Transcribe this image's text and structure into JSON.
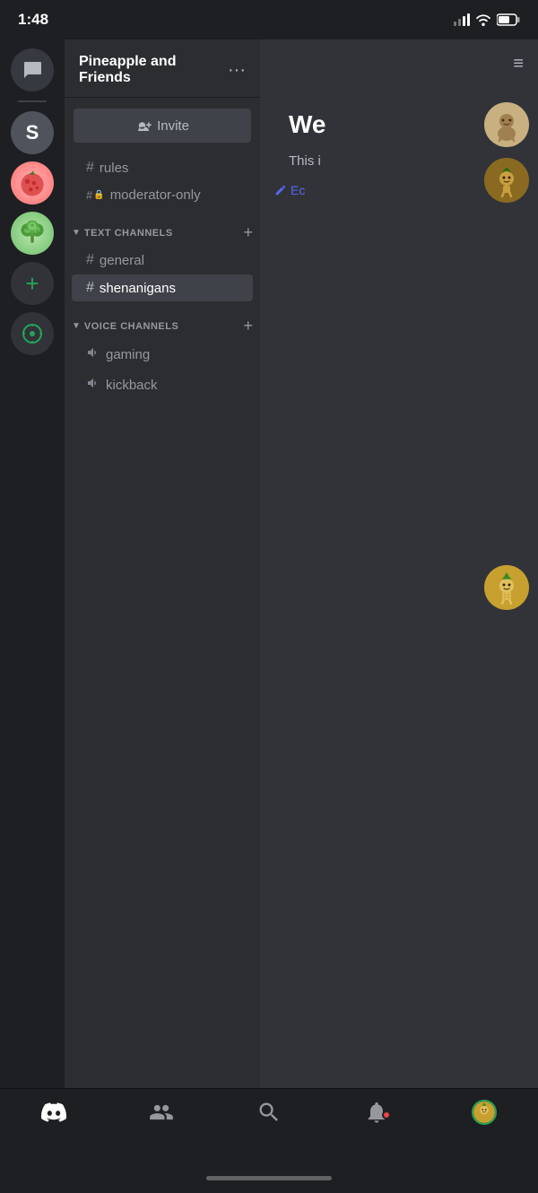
{
  "statusBar": {
    "time": "1:48",
    "signalBars": "▂▄",
    "wifi": "wifi",
    "battery": "battery"
  },
  "serverSidebar": {
    "items": [
      {
        "id": "chat",
        "type": "chat",
        "label": "Chat"
      },
      {
        "id": "s-server",
        "type": "letter",
        "letter": "S",
        "label": "S Server"
      },
      {
        "id": "strawberry",
        "type": "image",
        "label": "Strawberry Server"
      },
      {
        "id": "broccoli",
        "type": "image",
        "label": "Broccoli Server"
      },
      {
        "id": "add-server",
        "type": "add",
        "label": "Add Server"
      },
      {
        "id": "explore",
        "type": "explore",
        "label": "Explore Servers"
      }
    ]
  },
  "channelPanel": {
    "serverName": "Pineapple and Friends",
    "moreLabel": "···",
    "inviteButton": "Invite",
    "standaloneChannels": [
      {
        "id": "rules",
        "name": "rules",
        "icon": "#"
      },
      {
        "id": "moderator-only",
        "name": "moderator-only",
        "icon": "#🔒"
      }
    ],
    "categories": [
      {
        "id": "text-channels",
        "name": "TEXT CHANNELS",
        "channels": [
          {
            "id": "general",
            "name": "general",
            "icon": "#",
            "active": false
          },
          {
            "id": "shenanigans",
            "name": "shenanigans",
            "icon": "#",
            "active": true
          }
        ]
      },
      {
        "id": "voice-channels",
        "name": "VOICE CHANNELS",
        "channels": [
          {
            "id": "gaming",
            "name": "gaming",
            "icon": "🔊",
            "active": false
          },
          {
            "id": "kickback",
            "name": "kickback",
            "icon": "🔊",
            "active": false
          }
        ]
      }
    ]
  },
  "rightPanel": {
    "welcomeText": "We",
    "welcomeSub": "This i",
    "editLabel": "Ec"
  },
  "tabBar": {
    "tabs": [
      {
        "id": "home",
        "icon": "discord",
        "label": "Home"
      },
      {
        "id": "friends",
        "icon": "friends",
        "label": "Friends"
      },
      {
        "id": "search",
        "icon": "search",
        "label": "Search"
      },
      {
        "id": "notifications",
        "icon": "bell",
        "label": "Notifications",
        "badge": true
      },
      {
        "id": "profile",
        "icon": "profile",
        "label": "Profile"
      }
    ]
  }
}
